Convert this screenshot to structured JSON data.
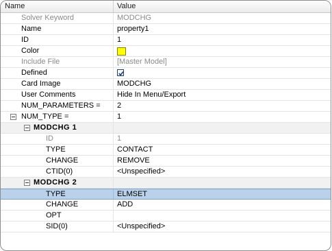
{
  "columns": {
    "name": "Name",
    "value": "Value"
  },
  "rows": {
    "solver_keyword": {
      "label": "Solver Keyword",
      "value": "MODCHG"
    },
    "name": {
      "label": "Name",
      "value": "property1"
    },
    "id": {
      "label": "ID",
      "value": "1"
    },
    "color": {
      "label": "Color",
      "swatch": "#ffff00"
    },
    "include_file": {
      "label": "Include File",
      "value": "[Master Model]"
    },
    "defined": {
      "label": "Defined",
      "checked": true
    },
    "card_image": {
      "label": "Card Image",
      "value": "MODCHG"
    },
    "user_comments": {
      "label": "User Comments",
      "value": "Hide In Menu/Export"
    },
    "num_parameters": {
      "label": "NUM_PARAMETERS =",
      "value": "2"
    },
    "num_type": {
      "label": "NUM_TYPE =",
      "value": "1"
    }
  },
  "modchg1": {
    "title": "MODCHG 1",
    "id": {
      "label": "ID",
      "value": "1"
    },
    "type": {
      "label": "TYPE",
      "value": "CONTACT"
    },
    "change": {
      "label": "CHANGE",
      "value": "REMOVE"
    },
    "ctid": {
      "label": "CTID(0)",
      "value": "<Unspecified>"
    }
  },
  "modchg2": {
    "title": "MODCHG 2",
    "type": {
      "label": "TYPE",
      "value": "ELMSET"
    },
    "change": {
      "label": "CHANGE",
      "value": "ADD"
    },
    "opt": {
      "label": "OPT",
      "value": ""
    },
    "sid": {
      "label": "SID(0)",
      "value": "<Unspecified>"
    }
  },
  "colors": {
    "selection": "#b9d1ea",
    "swatch": "#ffff00"
  }
}
